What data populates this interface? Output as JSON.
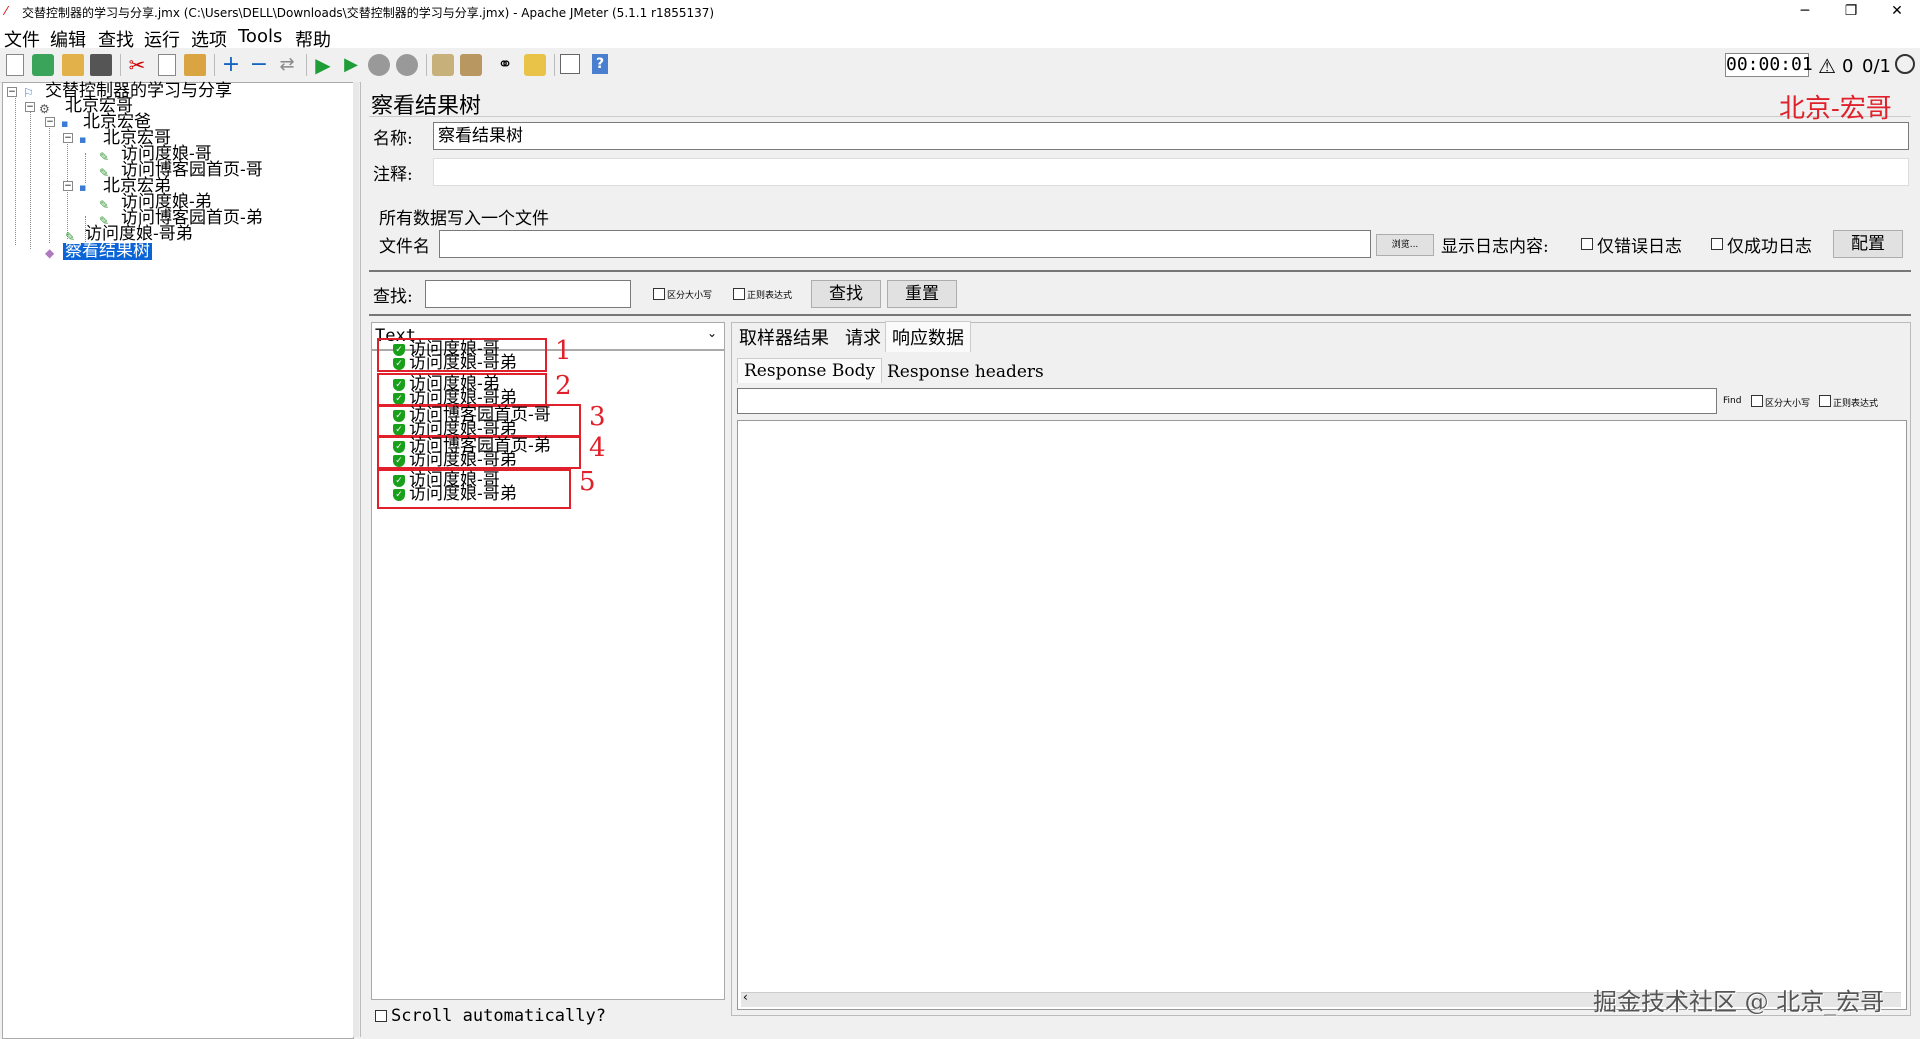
{
  "window": {
    "title": "交替控制器的学习与分享.jmx (C:\\Users\\DELL\\Downloads\\交替控制器的学习与分享.jmx) - Apache JMeter (5.1.1 r1855137)",
    "minimize": "─",
    "restore": "❐",
    "close": "✕"
  },
  "menu": [
    "文件",
    "编辑",
    "查找",
    "运行",
    "选项",
    "Tools",
    "帮助"
  ],
  "status": {
    "timer": "00:00:01",
    "warnings": "0",
    "threads": "0/1"
  },
  "tree": {
    "nodes": [
      {
        "label": "交替控制器的学习与分享"
      },
      {
        "label": "北京宏哥"
      },
      {
        "label": "北京宏爸"
      },
      {
        "label": "北京宏哥"
      },
      {
        "label": "访问度娘-哥"
      },
      {
        "label": "访问博客园首页-哥"
      },
      {
        "label": "北京宏弟"
      },
      {
        "label": "访问度娘-弟"
      },
      {
        "label": "访问博客园首页-弟"
      },
      {
        "label": "访问度娘-哥弟"
      },
      {
        "label": "察看结果树"
      }
    ]
  },
  "panel": {
    "title": "察看结果树",
    "watermark_top": "北京-宏哥",
    "name_label": "名称:",
    "name_value": "察看结果树",
    "comment_label": "注释:",
    "comment_value": "",
    "file_section": "所有数据写入一个文件",
    "file_label": "文件名",
    "file_value": "",
    "browse_button": "浏览...",
    "log_label": "显示日志内容:",
    "errors_only": "仅错误日志",
    "success_only": "仅成功日志",
    "config_button": "配置",
    "search_label": "查找:",
    "search_value": "",
    "case_sensitive": "区分大小写",
    "regex": "正则表达式",
    "find_button": "查找",
    "reset_button": "重置",
    "renderer": "Text",
    "scroll_auto": "Scroll automatically?",
    "tabs": [
      "取样器结果",
      "请求",
      "响应数据"
    ],
    "subtabs": [
      "Response Body",
      "Response headers"
    ],
    "find_label": "Find",
    "find_case": "区分大小写",
    "find_regex": "正则表达式",
    "watermark_bottom": "掘金技术社区 @ 北京_宏哥"
  },
  "results": [
    {
      "group": "1",
      "items": [
        "访问度娘-哥",
        "访问度娘-哥弟"
      ]
    },
    {
      "group": "2",
      "items": [
        "访问度娘-弟",
        "访问度娘-哥弟"
      ]
    },
    {
      "group": "3",
      "items": [
        "访问博客园首页-哥",
        "访问度娘-哥弟"
      ]
    },
    {
      "group": "4",
      "items": [
        "访问博客园首页-弟",
        "访问度娘-哥弟"
      ]
    },
    {
      "group": "5",
      "items": [
        "访问度娘-哥",
        "访问度娘-哥弟"
      ]
    }
  ],
  "colors": {
    "selection": "#0a64d6",
    "annotation_red": "#e0202a",
    "success_green": "#18a01b"
  }
}
